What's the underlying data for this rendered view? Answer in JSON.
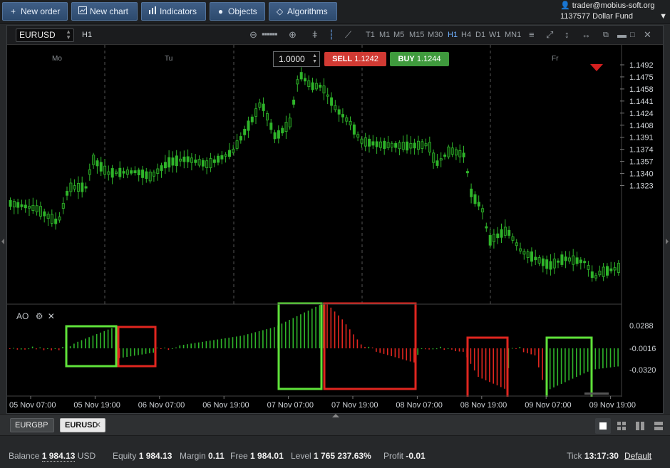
{
  "toolbar": {
    "new_order": "New order",
    "new_chart": "New chart",
    "indicators": "Indicators",
    "objects": "Objects",
    "algorithms": "Algorithms"
  },
  "account": {
    "user": "trader@mobius-soft.org",
    "id": "1137577",
    "fund": "Dollar Fund"
  },
  "chart": {
    "symbol": "EURUSD",
    "timeframe": "H1",
    "timeframes": [
      "T1",
      "M1",
      "M5",
      "M15",
      "M30",
      "H1",
      "H4",
      "D1",
      "W1",
      "MN1"
    ],
    "active_timeframe": "H1",
    "quantity": "1.0000",
    "sell_label": "SELL",
    "sell_price": "1.1242",
    "buy_label": "BUY",
    "buy_price": "1.1244",
    "indicator_label": "AO",
    "day_labels": [
      "Mo",
      "Tu",
      "Fr"
    ],
    "price_ticks": [
      "1.1492",
      "1.1475",
      "1.1458",
      "1.1441",
      "1.1424",
      "1.1408",
      "1.1391",
      "1.1374",
      "1.1357",
      "1.1340",
      "1.1323"
    ],
    "ao_ticks": [
      "0.0288",
      "-0.0016",
      "-0.0320"
    ],
    "time_ticks": [
      "05 Nov 07:00",
      "05 Nov 19:00",
      "06 Nov 07:00",
      "06 Nov 19:00",
      "07 Nov 07:00",
      "07 Nov 19:00",
      "08 Nov 07:00",
      "08 Nov 19:00",
      "09 Nov 07:00",
      "09 Nov 19:00"
    ],
    "colors": {
      "up": "#2fb52a",
      "down": "#e0261f",
      "box_green": "#5fe23a",
      "box_red": "#e0261f"
    }
  },
  "tabs": [
    {
      "label": "EURGBP",
      "active": false
    },
    {
      "label": "EURUSD",
      "active": true
    }
  ],
  "status": {
    "balance_label": "Balance",
    "balance_value": "1 984.13",
    "balance_currency": "USD",
    "equity_label": "Equity",
    "equity_value": "1 984.13",
    "margin_label": "Margin",
    "margin_value": "0.11",
    "free_label": "Free",
    "free_value": "1 984.01",
    "level_label": "Level",
    "level_value": "1 765 237.63%",
    "profit_label": "Profit",
    "profit_value": "-0.01",
    "tick_label": "Tick",
    "tick_value": "13:17:30",
    "default_label": "Default"
  }
}
